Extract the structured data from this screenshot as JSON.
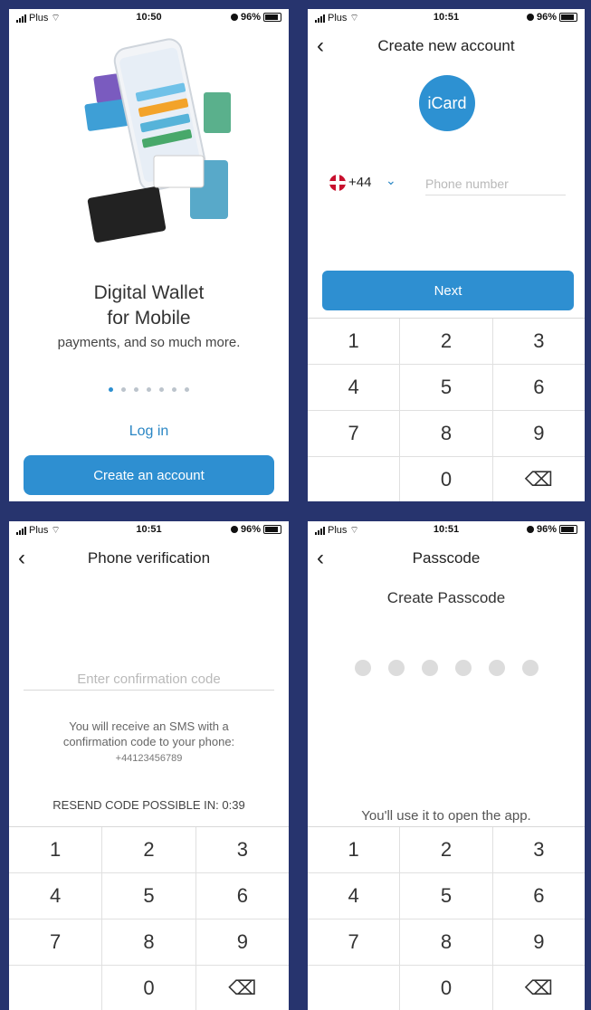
{
  "status_bars": [
    {
      "carrier": "Plus",
      "time": "10:50",
      "battery": "96%"
    },
    {
      "carrier": "Plus",
      "time": "10:51",
      "battery": "96%"
    },
    {
      "carrier": "Plus",
      "time": "10:51",
      "battery": "96%"
    },
    {
      "carrier": "Plus",
      "time": "10:51",
      "battery": "96%"
    }
  ],
  "welcome": {
    "title_line1": "Digital Wallet",
    "title_line2": "for Mobile",
    "subtitle": "payments, and so much more.",
    "pager_total": 7,
    "pager_active": 0,
    "login_label": "Log in",
    "create_account_label": "Create an account"
  },
  "create_account": {
    "title": "Create new account",
    "logo_text": "iCard",
    "country_code": "+44",
    "phone_placeholder": "Phone number",
    "next_label": "Next"
  },
  "verification": {
    "title": "Phone verification",
    "code_placeholder": "Enter confirmation code",
    "info_text": "You will receive an SMS with a confirmation code to your phone:",
    "phone_number": "+44123456789",
    "resend_text": "RESEND CODE POSSIBLE IN: 0:39"
  },
  "passcode": {
    "title": "Passcode",
    "heading": "Create Passcode",
    "dots": 6,
    "hint": "You'll use it to open the app."
  },
  "keypad": {
    "keys": [
      "1",
      "2",
      "3",
      "4",
      "5",
      "6",
      "7",
      "8",
      "9",
      "",
      "0",
      "⌫"
    ]
  },
  "colors": {
    "background": "#27346e",
    "accent": "#2e8fd1"
  }
}
